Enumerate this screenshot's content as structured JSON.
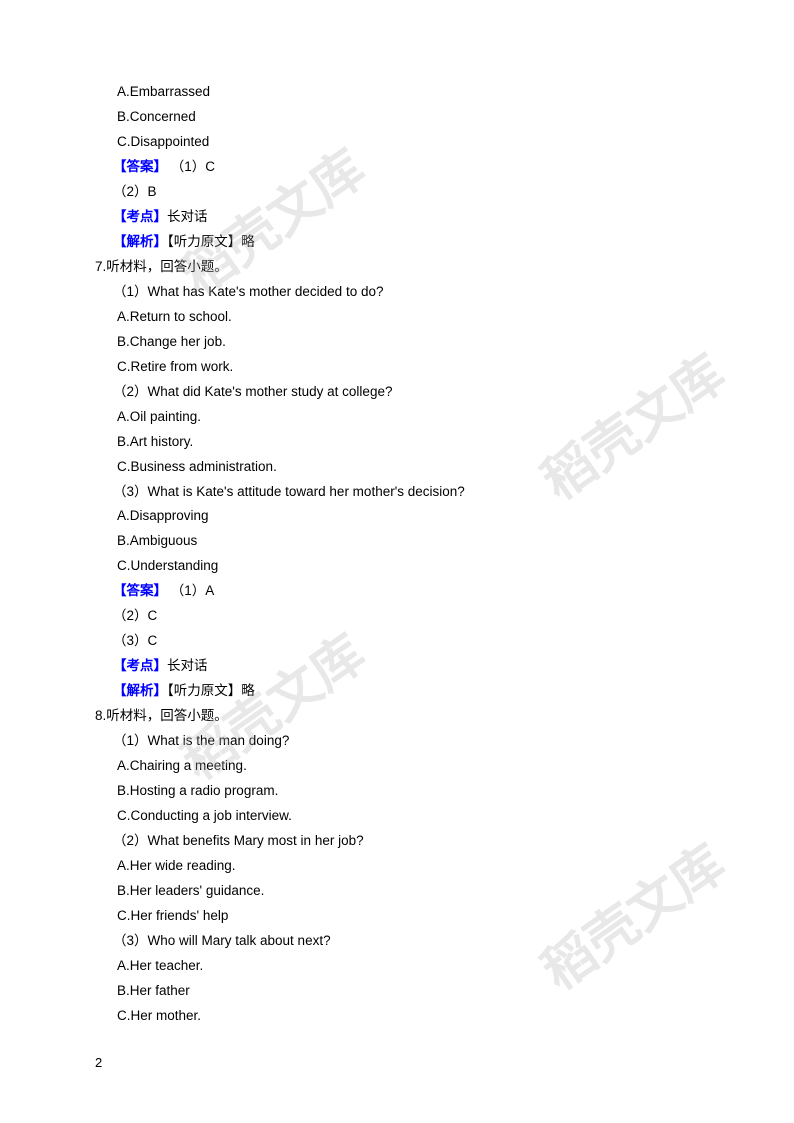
{
  "watermark_text": "稻壳文库",
  "page_number": "2",
  "q6_tail": {
    "opts": [
      "A.Embarrassed",
      "B.Concerned",
      "C.Disappointed"
    ],
    "answer_label": "【答案】",
    "answers": [
      "（1）C",
      "（2）B"
    ],
    "kaodian_label": "【考点】",
    "kaodian_text": "长对话",
    "jiexi_label": "【解析】",
    "jiexi_text": "【听力原文】略"
  },
  "q7": {
    "stem": "7.听材料，回答小题。",
    "p1": {
      "q": "（1）What has Kate's mother decided to do?",
      "opts": [
        "A.Return to school.",
        "B.Change her job.",
        "C.Retire from work."
      ]
    },
    "p2": {
      "q": "（2）What did Kate's mother study at college?",
      "opts": [
        "A.Oil painting.",
        "B.Art history.",
        "C.Business administration."
      ]
    },
    "p3": {
      "q": "（3）What is Kate's attitude toward her mother's decision?",
      "opts": [
        "A.Disapproving",
        "B.Ambiguous",
        "C.Understanding"
      ]
    },
    "answer_label": "【答案】",
    "answers": [
      "（1）A",
      "（2）C",
      "（3）C"
    ],
    "kaodian_label": "【考点】",
    "kaodian_text": "长对话",
    "jiexi_label": "【解析】",
    "jiexi_text": "【听力原文】略"
  },
  "q8": {
    "stem": "8.听材料，回答小题。",
    "p1": {
      "q": "（1）What is the man doing?",
      "opts": [
        "A.Chairing a meeting.",
        "B.Hosting a radio program.",
        "C.Conducting a job interview."
      ]
    },
    "p2": {
      "q": "（2）What benefits Mary most in her job?",
      "opts": [
        "A.Her wide reading.",
        "B.Her leaders' guidance.",
        "C.Her friends' help"
      ]
    },
    "p3": {
      "q": "（3）Who will Mary talk about next?",
      "opts": [
        "A.Her teacher.",
        "B.Her father",
        "C.Her mother."
      ]
    }
  }
}
